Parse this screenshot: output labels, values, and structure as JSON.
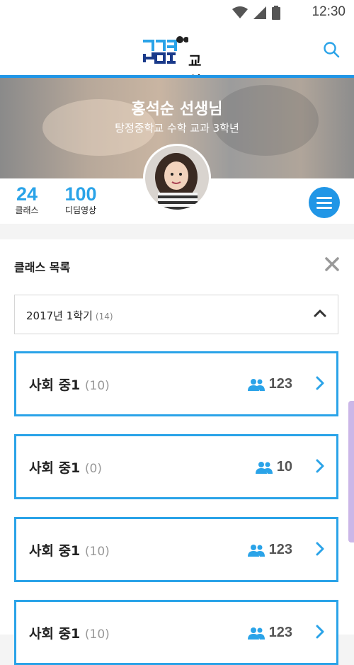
{
  "status_bar": {
    "time": "12:30"
  },
  "header": {
    "logo_text": "교실"
  },
  "profile": {
    "name": "홍석순 선생님",
    "subtitle": "탕정중학교 수학 교과 3학년"
  },
  "stats": [
    {
      "value": "24",
      "label": "클래스"
    },
    {
      "value": "100",
      "label": "디딤영상"
    }
  ],
  "panel": {
    "title": "클래스 목록",
    "semester": {
      "label": "2017년 1학기",
      "count": "(14)"
    }
  },
  "classes": [
    {
      "name": "사회 중1",
      "count": "(10)",
      "members": "123"
    },
    {
      "name": "사회 중1",
      "count": "(0)",
      "members": "10"
    },
    {
      "name": "사회 중1",
      "count": "(10)",
      "members": "123"
    },
    {
      "name": "사회 중1",
      "count": "(10)",
      "members": "123"
    }
  ],
  "colors": {
    "accent": "#2196e6",
    "card_border": "#2aa3e8",
    "stat_number": "#2aa3e8"
  },
  "icons": [
    "wifi-icon",
    "signal-icon",
    "battery-icon",
    "search-icon",
    "menu-icon",
    "close-icon",
    "chevron-up-icon",
    "people-icon",
    "chevron-right-icon"
  ]
}
